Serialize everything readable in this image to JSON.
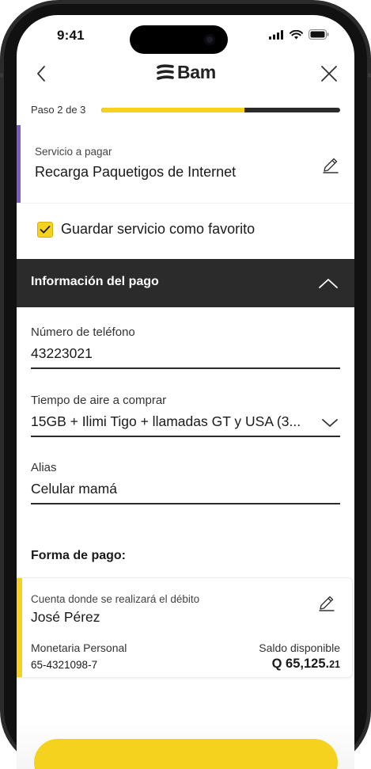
{
  "status_bar": {
    "time": "9:41"
  },
  "navbar": {
    "logo_text": "Bam"
  },
  "steps": {
    "label": "Paso 2 de 3",
    "progress": 0.6
  },
  "service": {
    "label": "Servicio a pagar",
    "value": "Recarga Paquetigos de Internet"
  },
  "favorite": {
    "label": "Guardar servicio como favorito",
    "checked": true
  },
  "section": {
    "title": "Información del pago"
  },
  "fields": {
    "phone": {
      "label": "Número de teléfono",
      "value": "43223021"
    },
    "airtime": {
      "label": "Tiempo de aire a comprar",
      "value": "15GB + Ilimi Tigo + llamadas GT y USA (3..."
    },
    "alias": {
      "label": "Alias",
      "value": "Celular mamá"
    }
  },
  "payment": {
    "title": "Forma de pago:",
    "account_label": "Cuenta donde se realizará el débito",
    "account_name": "José Pérez",
    "account_type": "Monetaria Personal",
    "account_number": "65-4321098-7",
    "balance_label": "Saldo disponible",
    "balance_main": "Q 65,125.",
    "balance_cents": "21"
  },
  "colors": {
    "brand_yellow": "#f5d21e",
    "dark": "#2b2b2b",
    "service_accent": "#7b5cc9"
  },
  "icons": [
    "back-arrow-icon",
    "close-icon",
    "pencil-icon",
    "check-icon",
    "chevron-up-icon",
    "chevron-down-icon",
    "signal-icon",
    "wifi-icon",
    "battery-icon"
  ]
}
